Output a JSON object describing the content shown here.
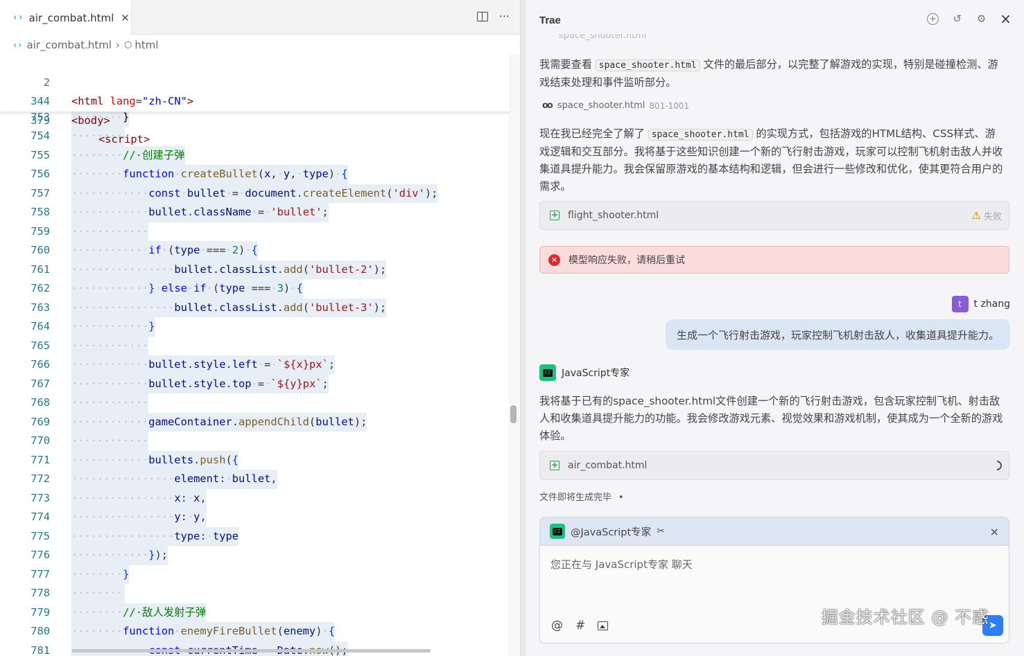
{
  "editor": {
    "tab": {
      "icon": "html-file-icon",
      "label": "air_combat.html",
      "close": "✕"
    },
    "breadcrumb": {
      "file": "air_combat.html",
      "element": "html"
    },
    "sticky": [
      {
        "num": "2",
        "text": "<html lang=\"zh-CN\">"
      },
      {
        "num": "344",
        "text": "<body>"
      },
      {
        "num": "379",
        "text": "<script>"
      }
    ],
    "line_numbers": [
      "753",
      "754",
      "755",
      "756",
      "757",
      "758",
      "759",
      "760",
      "761",
      "762",
      "763",
      "764",
      "765",
      "766",
      "767",
      "768",
      "769",
      "770",
      "771",
      "772",
      "773",
      "774",
      "775",
      "776",
      "777",
      "778",
      "779",
      "780",
      "781"
    ]
  },
  "chat": {
    "title": "Trae",
    "faded_ref": "space_shooter.html",
    "para1": {
      "a": "我需要查看 ",
      "chip": "space_shooter.html",
      "b": " 文件的最后部分，以完整了解游戏的实现，特别是碰撞检测、游戏结束处理和事件监听部分。"
    },
    "ref": {
      "file": "space_shooter.html",
      "range": "801-1001"
    },
    "para2": {
      "a": "现在我已经完全了解了 ",
      "chip": "space_shooter.html",
      "b": " 的实现方式，包括游戏的HTML结构、CSS样式、游戏逻辑和交互部分。我将基于这些知识创建一个新的飞行射击游戏，玩家可以控制飞机射击敌人并收集道具提升能力。我会保留原游戏的基本结构和逻辑，但会进行一些修改和优化，使其更符合用户的需求。"
    },
    "file_card_1": {
      "name": "flight_shooter.html",
      "status": "失败"
    },
    "error": "模型响应失败，请稍后重试",
    "user": {
      "avatar": "t",
      "name": "t zhang",
      "message": "生成一个飞行射击游戏，玩家控制飞机射击敌人，收集道具提升能力。"
    },
    "assistant": {
      "name": "JavaScript专家",
      "logo_text": "CI"
    },
    "para3": "我将基于已有的space_shooter.html文件创建一个新的飞行射击游戏，包含玩家控制飞机、射击敌人和收集道具提升能力的功能。我会修改游戏元素、视觉效果和游戏机制，使其成为一个全新的游戏体验。",
    "file_card_2": {
      "name": "air_combat.html"
    },
    "gen_status": "文件即将生成完毕",
    "composer": {
      "agent": "@JavaScript专家",
      "placeholder": "您正在与 JavaScript专家 聊天"
    },
    "watermark": "掘金技术社区 @ 不惑"
  }
}
